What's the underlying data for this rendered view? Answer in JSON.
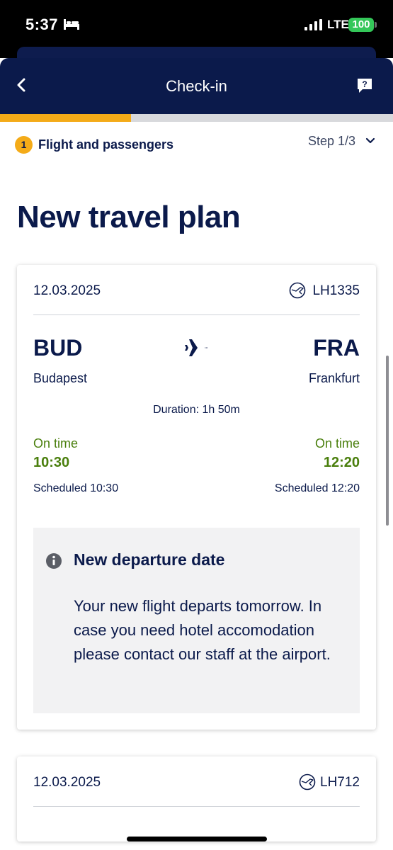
{
  "status_bar": {
    "time": "5:37",
    "network": "LTE",
    "battery": "100"
  },
  "header": {
    "title": "Check-in"
  },
  "progress": {
    "fraction": 0.333
  },
  "step": {
    "number": "1",
    "label": "Flight and passengers",
    "count": "Step 1/3"
  },
  "page_title": "New travel plan",
  "flights": [
    {
      "date": "12.03.2025",
      "flight_number": "LH1335",
      "origin_code": "BUD",
      "origin_city": "Budapest",
      "destination_code": "FRA",
      "destination_city": "Frankfurt",
      "duration": "Duration: 1h 50m",
      "departure_status": "On time",
      "departure_time": "10:30",
      "departure_scheduled": "Scheduled 10:30",
      "arrival_status": "On time",
      "arrival_time": "12:20",
      "arrival_scheduled": "Scheduled 12:20",
      "notice": {
        "title": "New departure date",
        "body": "Your new flight departs tomorrow. In case you need hotel accomodation please contact our staff at the airport."
      }
    },
    {
      "date": "12.03.2025",
      "flight_number": "LH712"
    }
  ],
  "colors": {
    "navy": "#0b1a4b",
    "accent": "#f4ab18",
    "on_time": "#4a7f0d"
  },
  "icons": [
    "bed-icon",
    "signal-icon",
    "back-chevron-icon",
    "help-icon",
    "chevron-down-icon",
    "airline-logo-icon",
    "airplane-icon",
    "info-icon"
  ]
}
